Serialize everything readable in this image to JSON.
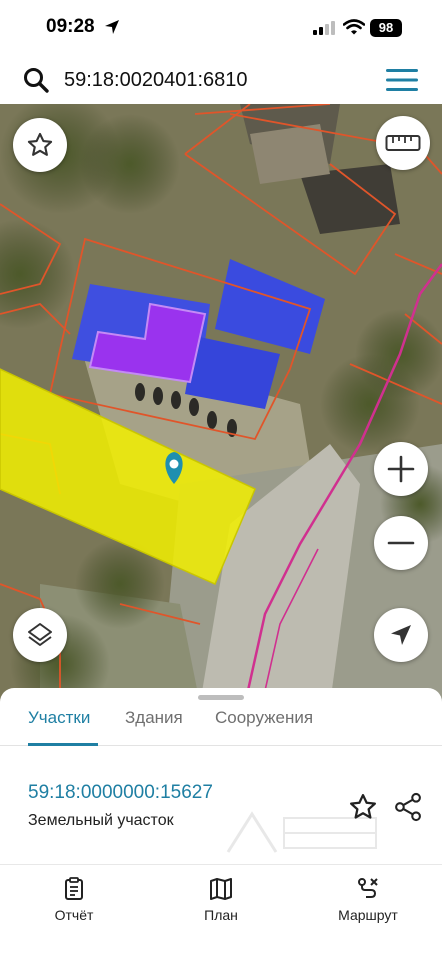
{
  "status_bar": {
    "time": "09:28",
    "battery": "98"
  },
  "search": {
    "query": "59:18:0020401:6810"
  },
  "map": {
    "selected_parcel_color": "#f2f000",
    "building_color": "#3f4fe0",
    "highlight_color": "#9a33ee",
    "boundary_color": "#e0552a",
    "marker_color": "#1f8fb0",
    "road_line_color": "#d0308f"
  },
  "sheet": {
    "tabs": [
      {
        "label": "Участки",
        "active": true
      },
      {
        "label": "Здания",
        "active": false
      },
      {
        "label": "Сооружения",
        "active": false
      }
    ],
    "result": {
      "number": "59:18:0000000:15627",
      "type": "Земельный участок"
    }
  },
  "bottom_nav": {
    "items": [
      {
        "label": "Отчёт",
        "icon": "report-icon"
      },
      {
        "label": "План",
        "icon": "map-plan-icon"
      },
      {
        "label": "Маршрут",
        "icon": "route-icon"
      }
    ]
  },
  "theme": {
    "accent": "#1f7fa3"
  }
}
